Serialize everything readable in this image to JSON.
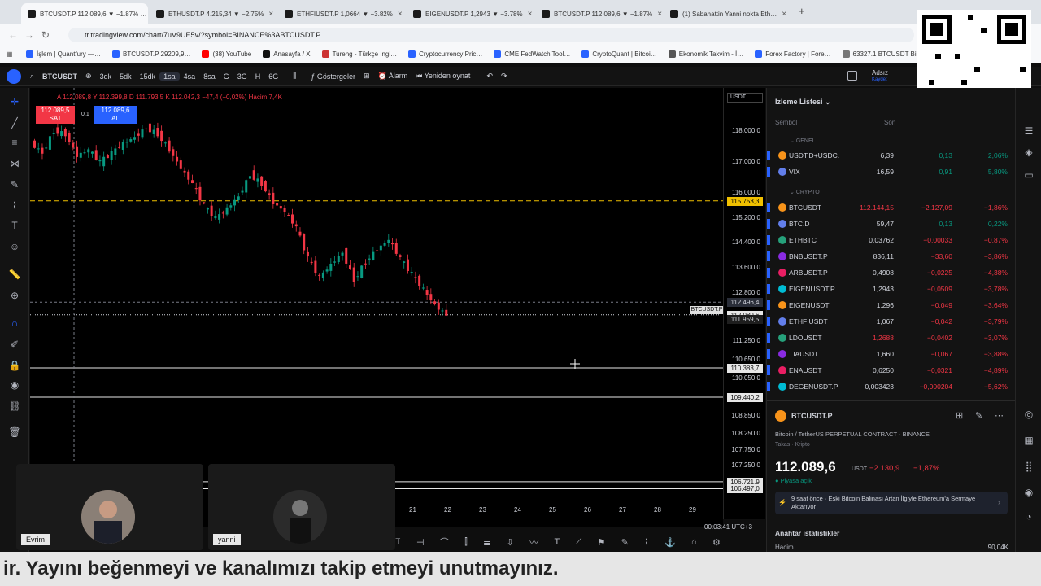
{
  "browser": {
    "tabs": [
      {
        "label": "BTCUSDT.P 112.089,6 ▼ −1.87% …",
        "active": true
      },
      {
        "label": "ETHUSDT.P 4.215,34 ▼ −2.75%",
        "active": false
      },
      {
        "label": "ETHFIUSDT.P 1,0664 ▼ −3.82%",
        "active": false
      },
      {
        "label": "EIGENUSDT.P 1,2943 ▼ −3.78%",
        "active": false
      },
      {
        "label": "BTCUSDT.P 112.089,6 ▼ −1.87%",
        "active": false
      },
      {
        "label": "(1) Sabahattin Yanni nokta Eth…",
        "active": false
      }
    ],
    "url": "tr.tradingview.com/chart/7uV9UE5v/?symbol=BINANCE%3ABTCUSDT.P",
    "bookmarks": [
      "İşlem | Quantfury —…",
      "BTCUSDT.P 29209,9…",
      "(38) YouTube",
      "Anasayfa / X",
      "Tureng - Türkçe İngi…",
      "Cryptocurrency Pric…",
      "CME FedWatch Tool…",
      "CryptoQuant | Bitcoi…",
      "Ekonomik Takvim - İ…",
      "Forex Factory | Fore…",
      "63327.1 BTCUSDT Bi…"
    ]
  },
  "toolbar": {
    "symbol": "BTCUSDT",
    "intervals": [
      "3dk",
      "5dk",
      "15dk",
      "1sa",
      "4sa",
      "8sa",
      "G",
      "3G",
      "H",
      "6G"
    ],
    "active_interval": "1sa",
    "indicators": "Göstergeler",
    "alarm": "Alarm",
    "replay": "Yeniden oynat",
    "user": "Adsız",
    "user_sub": "Kaydet"
  },
  "chart": {
    "ohlc": "A 112.089,8  Y 112.399,8  D 111.793,5  K 112.042,3  −47,4 (−0,02%)  Hacim 7,4K",
    "sell_price": "112.089,5",
    "sell_label": "SAT",
    "spread": "0,1",
    "buy_price": "112.089,6",
    "buy_label": "AL",
    "currency": "USDT",
    "price_ticks": [
      "118.000,0",
      "117.000,0",
      "116.000,0",
      "115.200,0",
      "114.400,0",
      "113.600,0",
      "112.800,0",
      "111.250,0",
      "110.650,0",
      "110.050,0",
      "108.850,0",
      "108.250,0",
      "107.750,0",
      "107.250,0"
    ],
    "price_markers": [
      {
        "label": "115.753,3",
        "kind": "yellow"
      },
      {
        "label": "112.496,4",
        "kind": "gray"
      },
      {
        "label": "112.089,6",
        "kind": "white"
      },
      {
        "label": "111.959,5",
        "kind": "dark"
      },
      {
        "label": "110.383,7",
        "kind": "white"
      },
      {
        "label": "109.440,2",
        "kind": "white"
      },
      {
        "label": "106.721,9",
        "kind": "white"
      },
      {
        "label": "106.497,0",
        "kind": "white"
      }
    ],
    "symbol_tag": "BTCUSDT.P",
    "time_ticks": [
      "21",
      "22",
      "23",
      "24",
      "25",
      "26",
      "27",
      "28",
      "29"
    ],
    "clock": "00:03:41 UTC+3",
    "chart_data": {
      "type": "candlestick",
      "interval": "1h",
      "close_price_path": [
        117600,
        117300,
        118000,
        117900,
        117200,
        117400,
        117000,
        117300,
        117600,
        117800,
        118100,
        117900,
        117400,
        116800,
        116300,
        115600,
        115200,
        115500,
        115900,
        116600,
        116300,
        115700,
        115400,
        114900,
        113900,
        113300,
        113700,
        114100,
        113200,
        113800,
        114200,
        114500,
        113900,
        113400,
        112900,
        112400,
        112089.6
      ],
      "ylim": [
        106300,
        118600
      ]
    }
  },
  "watchlist": {
    "title": "İzleme Listesi",
    "col_symbol": "Sembol",
    "col_last": "Son",
    "col_change": "Değ",
    "section_general": "GENEL",
    "section_crypto": "CRYPTO",
    "general": [
      {
        "sym": "USDT.D+USDC.",
        "last": "6,39",
        "chg": "0,13",
        "pct": "2,06%",
        "dir": "up"
      },
      {
        "sym": "VIX",
        "last": "16,59",
        "chg": "0,91",
        "pct": "5,80%",
        "dir": "up"
      }
    ],
    "crypto": [
      {
        "sym": "BTCUSDT",
        "last": "112.144,15",
        "chg": "−2.127,09",
        "pct": "−1,86%",
        "dir": "down"
      },
      {
        "sym": "BTC.D",
        "last": "59,47",
        "chg": "0,13",
        "pct": "0,22%",
        "dir": "up"
      },
      {
        "sym": "ETHBTC",
        "last": "0,03762",
        "chg": "−0,00033",
        "pct": "−0,87%",
        "dir": "down"
      },
      {
        "sym": "BNBUSDT.P",
        "last": "836,11",
        "chg": "−33,60",
        "pct": "−3,86%",
        "dir": "down"
      },
      {
        "sym": "ARBUSDT.P",
        "last": "0,4908",
        "chg": "−0,0225",
        "pct": "−4,38%",
        "dir": "down"
      },
      {
        "sym": "EIGENUSDT.P",
        "last": "1,2943",
        "chg": "−0,0509",
        "pct": "−3,78%",
        "dir": "down"
      },
      {
        "sym": "EIGENUSDT",
        "last": "1,296",
        "chg": "−0,049",
        "pct": "−3,64%",
        "dir": "down"
      },
      {
        "sym": "ETHFIUSDT",
        "last": "1,067",
        "chg": "−0,042",
        "pct": "−3,79%",
        "dir": "down"
      },
      {
        "sym": "LDOUSDT",
        "last": "1,2688",
        "chg": "−0,0402",
        "pct": "−3,07%",
        "dir": "down"
      },
      {
        "sym": "TIAUSDT",
        "last": "1,660",
        "chg": "−0,067",
        "pct": "−3,88%",
        "dir": "down"
      },
      {
        "sym": "ENAUSDT",
        "last": "0,6250",
        "chg": "−0,0321",
        "pct": "−4,89%",
        "dir": "down"
      },
      {
        "sym": "DEGENUSDT.P",
        "last": "0,003423",
        "chg": "−0,000204",
        "pct": "−5,62%",
        "dir": "down"
      }
    ]
  },
  "detail": {
    "symbol": "BTCUSDT.P",
    "name": "Bitcoin / TetherUS PERPETUAL CONTRACT",
    "exchange": "BINANCE",
    "category": "Takas · Kripto",
    "price": "112.089,6",
    "currency": "USDT",
    "change": "−2.130,9",
    "change_pct": "−1,87%",
    "market_status": "Piyasa açık",
    "news": "9 saat önce · Eski Bitcoin Balinası Artan İlgiyle Ethereum'a Sermaye Aktarıyor",
    "stats_title": "Anahtar istatistikler",
    "volume_label": "Hacim",
    "volume_value": "90,04K"
  },
  "webcams": [
    {
      "name": "Evrim"
    },
    {
      "name": "yanni"
    }
  ],
  "subtitle": "ir. Yayını beğenmeyi ve kanalımızı takip etmeyi unutmayınız."
}
